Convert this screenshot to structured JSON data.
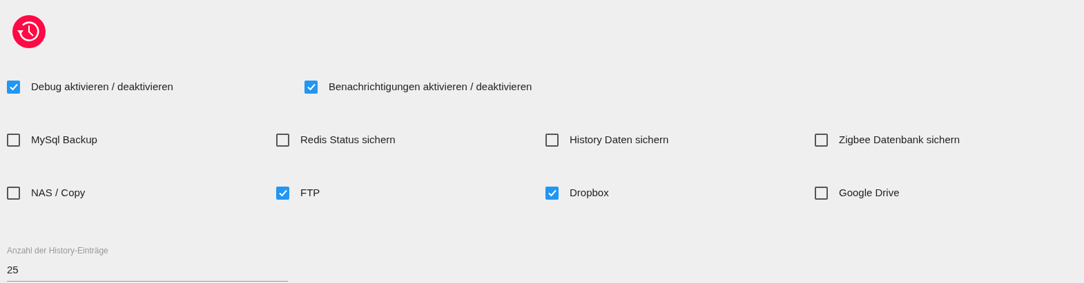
{
  "option_rows": [
    [
      {
        "label": "Debug aktivieren / deaktivieren",
        "checked": true
      },
      {
        "label": "Benachrichtigungen aktivieren / deaktivieren",
        "checked": true
      }
    ],
    [
      {
        "label": "MySql Backup",
        "checked": false
      },
      {
        "label": "Redis Status sichern",
        "checked": false
      },
      {
        "label": "History Daten sichern",
        "checked": false
      },
      {
        "label": "Zigbee Datenbank sichern",
        "checked": false
      }
    ],
    [
      {
        "label": "NAS / Copy",
        "checked": false
      },
      {
        "label": "FTP",
        "checked": true
      },
      {
        "label": "Dropbox",
        "checked": true
      },
      {
        "label": "Google Drive",
        "checked": false
      }
    ]
  ],
  "history_field": {
    "label": "Anzahl der History-Einträge",
    "value": "25"
  }
}
